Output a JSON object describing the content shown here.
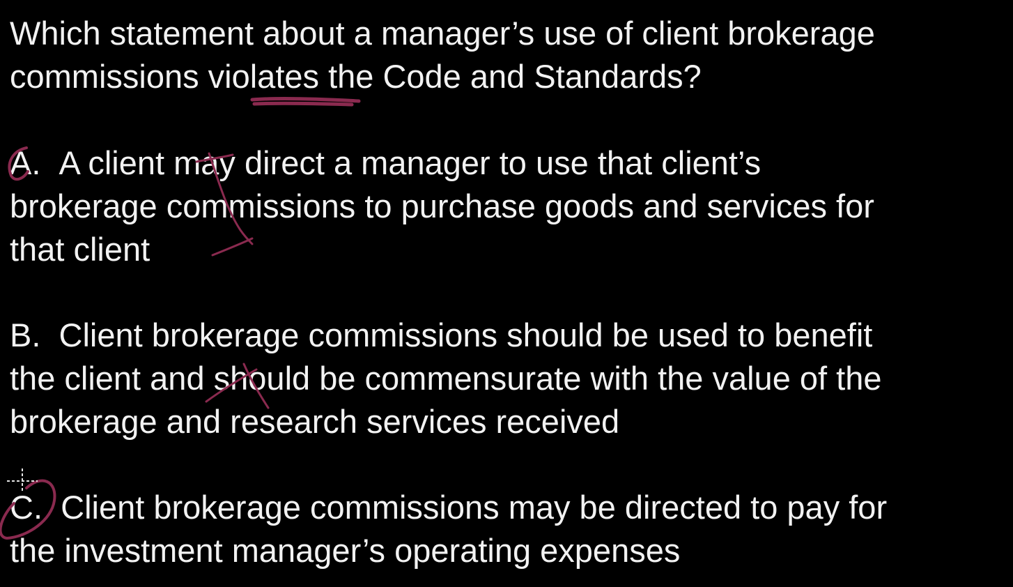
{
  "question": {
    "lines": [
      "Which statement about a manager’s use of client brokerage",
      "commissions violates the Code and Standards?"
    ]
  },
  "options": [
    {
      "letter": "A.",
      "lines": [
        "A client may direct a manager to use that client’s",
        "brokerage commissions to purchase goods and services for",
        "that client"
      ]
    },
    {
      "letter": "B.",
      "lines": [
        "Client brokerage commissions should be used to benefit",
        "the client and should be commensurate with the value of the",
        "brokerage and research services received"
      ]
    },
    {
      "letter": "C.",
      "lines": [
        "Client brokerage commissions may be directed to pay for",
        "the investment manager’s operating expenses"
      ]
    }
  ],
  "annotations": {
    "ink_color": "#8a2a4f",
    "marks": [
      "underline-violates",
      "check-option-a",
      "cross-option-a",
      "cross-option-b",
      "circle-option-c"
    ]
  },
  "colors": {
    "background": "#000000",
    "text": "#f2f2f2"
  }
}
